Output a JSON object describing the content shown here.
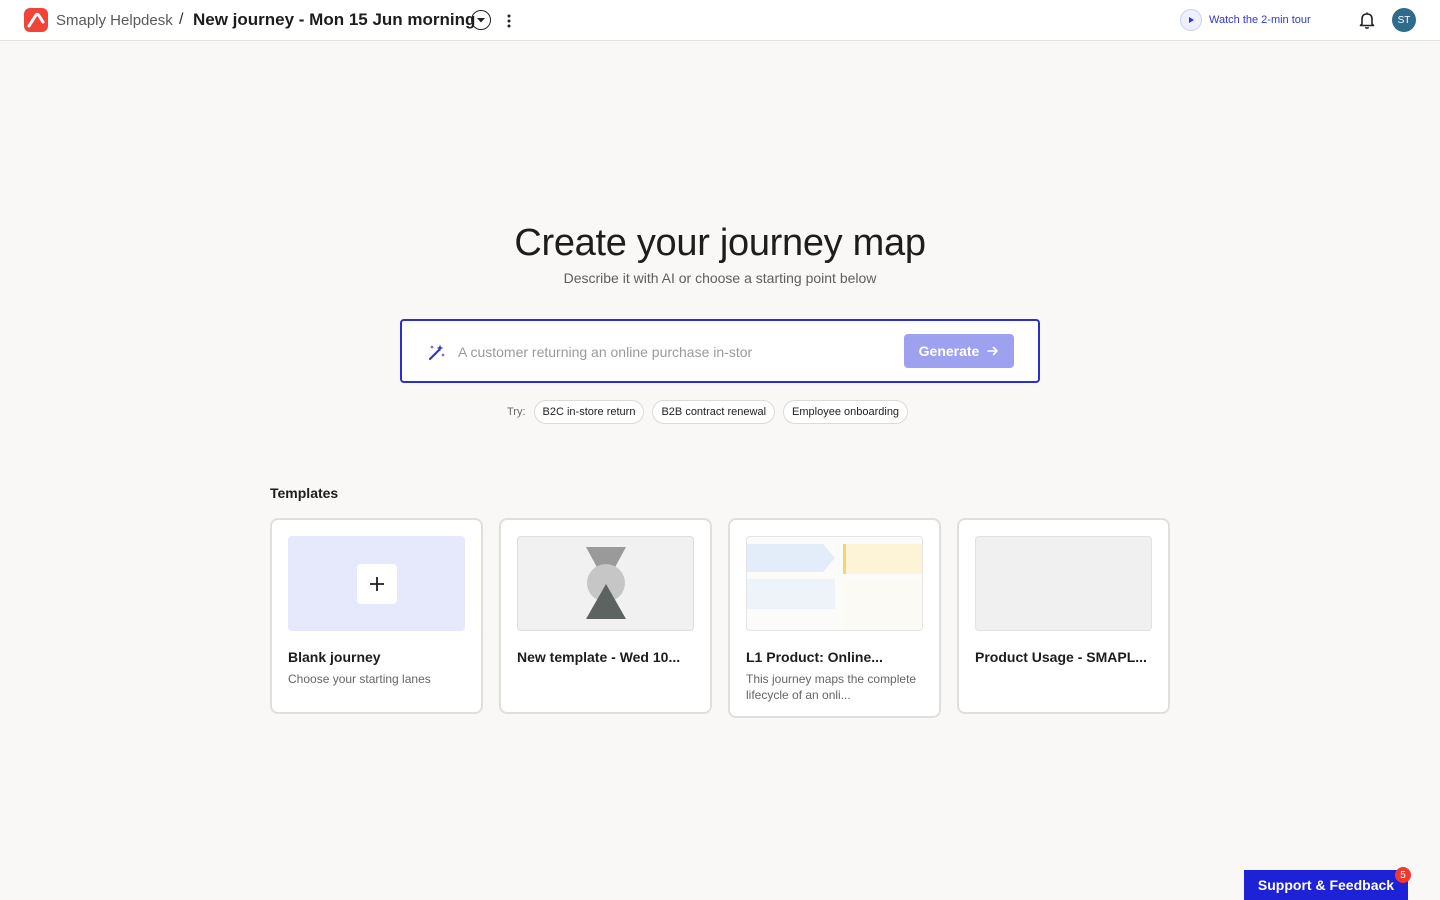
{
  "header": {
    "app_name": "Smaply Helpdesk",
    "separator": "/",
    "journey_title": "New journey - Mon 15 Jun morning",
    "tour_label": "Watch the 2-min tour",
    "avatar_initials": "ST",
    "brand_color": "#f04438",
    "accent_color": "#2b2fd0"
  },
  "hero": {
    "title": "Create your journey map",
    "subtitle": "Describe it with AI or choose a starting point below",
    "input_placeholder": "A customer returning an online purchase in-stor",
    "generate_label": "Generate",
    "try_label": "Try:",
    "suggestions": [
      "B2C in-store return",
      "B2B contract renewal",
      "Employee onboarding"
    ]
  },
  "templates": {
    "heading": "Templates",
    "cards": [
      {
        "title": "Blank journey",
        "description": "Choose your starting lanes"
      },
      {
        "title": "New template - Wed 10...",
        "description": ""
      },
      {
        "title": "L1 Product: Online...",
        "description": "This journey maps the complete lifecycle of an onli..."
      },
      {
        "title": "Product Usage - SMAPL...",
        "description": ""
      }
    ]
  },
  "support": {
    "label": "Support & Feedback",
    "badge_count": "5"
  }
}
